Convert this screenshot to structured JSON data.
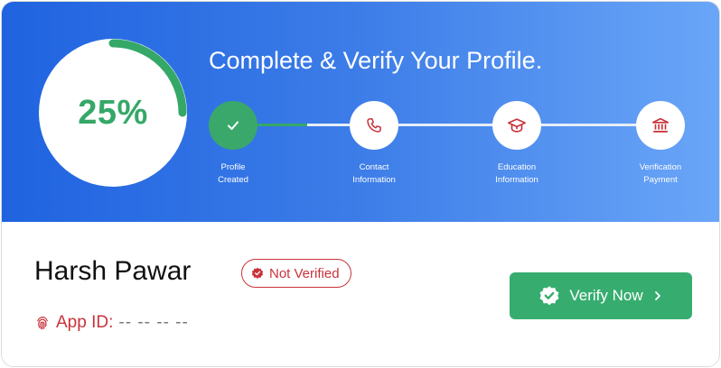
{
  "progress": {
    "value": 0.25,
    "label": "25%"
  },
  "headline": "Complete & Verify Your Profile.",
  "steps": [
    {
      "label_line1": "Profile",
      "label_line2": "Created",
      "icon": "check-icon",
      "status": "done"
    },
    {
      "label_line1": "Contact",
      "label_line2": "Information",
      "icon": "phone-icon",
      "status": "pending"
    },
    {
      "label_line1": "Education",
      "label_line2": "Information",
      "icon": "graduation-cap-icon",
      "status": "pending"
    },
    {
      "label_line1": "Verification",
      "label_line2": "Payment",
      "icon": "bank-icon",
      "status": "pending"
    }
  ],
  "profile": {
    "name": "Harsh Pawar",
    "status_badge": "Not Verified",
    "app_id_label": "App ID:",
    "app_id_value": "-- -- -- --"
  },
  "verify_button": {
    "label": "Verify Now"
  },
  "colors": {
    "banner_start": "#1f63e0",
    "banner_end": "#6aa6f8",
    "success": "#36ad6f",
    "danger": "#c8333a"
  }
}
